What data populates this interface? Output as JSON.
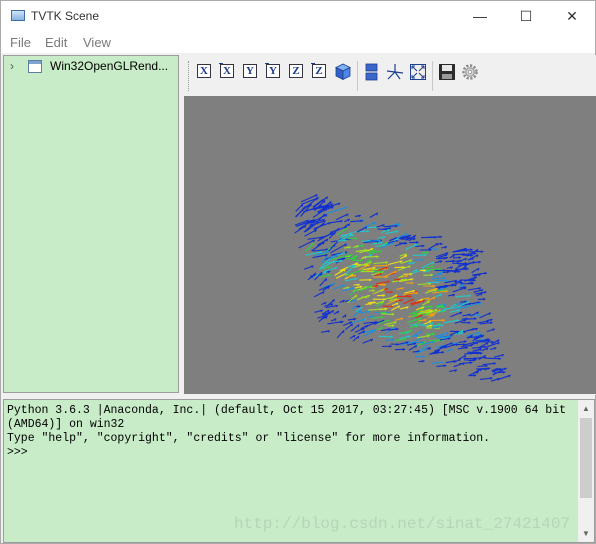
{
  "window": {
    "title": "TVTK Scene",
    "minimize": "—",
    "maximize": "☐",
    "close": "✕"
  },
  "menu": {
    "items": [
      {
        "label": "File"
      },
      {
        "label": "Edit"
      },
      {
        "label": "View"
      }
    ]
  },
  "tree": {
    "node_label": "Win32OpenGLRend..."
  },
  "toolbar": {
    "buttons": [
      {
        "name": "view-x-plus",
        "glyph": "X",
        "icon": "x-axis-view-icon"
      },
      {
        "name": "view-x-minus",
        "glyph": "X",
        "icon": "x-axis-view-icon"
      },
      {
        "name": "view-y-plus",
        "glyph": "Y",
        "icon": "y-axis-view-icon"
      },
      {
        "name": "view-y-minus",
        "glyph": "Y",
        "icon": "y-axis-view-icon"
      },
      {
        "name": "view-z-plus",
        "glyph": "Z",
        "icon": "z-axis-view-icon"
      },
      {
        "name": "view-z-minus",
        "glyph": "Z",
        "icon": "z-axis-view-icon"
      },
      {
        "name": "isometric-view",
        "icon": "cube-icon"
      },
      {
        "name": "parallel-projection",
        "icon": "projection-icon"
      },
      {
        "name": "show-axes",
        "icon": "axes-icon"
      },
      {
        "name": "full-screen",
        "icon": "fullscreen-icon"
      },
      {
        "name": "save",
        "icon": "save-icon"
      },
      {
        "name": "configure",
        "icon": "gear-icon"
      }
    ]
  },
  "console": {
    "lines": [
      "Python 3.6.3 |Anaconda, Inc.| (default, Oct 15 2017, 03:27:45) [MSC v.1900 64 bit",
      "(AMD64)] on win32",
      "Type \"help\", \"copyright\", \"credits\" or \"license\" for more information.",
      ">>>"
    ],
    "watermark": "http://blog.csdn.net/sinat_27421407"
  },
  "colors": {
    "panel_bg": "#c8ecc8",
    "scene_bg": "#7f7f7f",
    "arrow_palette": [
      "#1030d0",
      "#1a90e0",
      "#20c8c8",
      "#30d040",
      "#a0e020",
      "#f0e010",
      "#f0a010",
      "#e03010"
    ]
  }
}
